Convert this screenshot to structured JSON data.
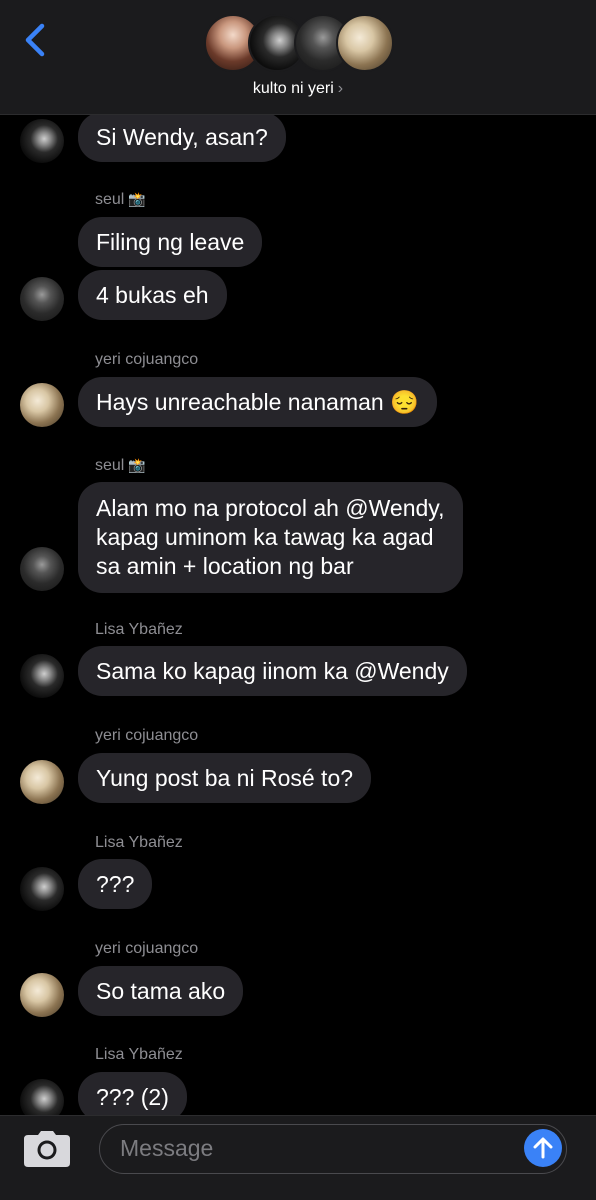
{
  "header": {
    "group_name": "kulto ni yeri",
    "chevron": "›",
    "back_icon": "chevron-left-icon",
    "accent_color": "#3a82f7"
  },
  "messages": [
    {
      "sender": "",
      "text": "Si Wendy, asan?",
      "avatar": "lisa"
    },
    {
      "sender": "seul",
      "sender_emoji": "📸",
      "text": "Filing ng leave",
      "avatar": ""
    },
    {
      "sender": "",
      "text": "4 bukas eh",
      "avatar": "seul"
    },
    {
      "sender": "yeri cojuangco",
      "text": "Hays unreachable nanaman 😔",
      "avatar": "yeri"
    },
    {
      "sender": "seul",
      "sender_emoji": "📸",
      "text": "Alam mo na protocol ah @Wendy, kapag uminom ka tawag ka agad sa amin + location ng bar",
      "lines": [
        "Alam mo na protocol ah @Wendy,",
        "kapag uminom ka tawag ka agad",
        "sa amin + location ng bar"
      ],
      "avatar": "seul"
    },
    {
      "sender": "Lisa Ybañez",
      "text": "Sama ko kapag iinom ka @Wendy",
      "avatar": "lisa"
    },
    {
      "sender": "yeri cojuangco",
      "text": "Yung post ba ni Rosé to?",
      "avatar": "yeri"
    },
    {
      "sender": "Lisa Ybañez",
      "text": "???",
      "avatar": "lisa"
    },
    {
      "sender": "yeri cojuangco",
      "text": "So tama ako",
      "avatar": "yeri"
    },
    {
      "sender": "Lisa Ybañez",
      "text": "??? (2)",
      "avatar": "lisa"
    }
  ],
  "composer": {
    "placeholder": "Message",
    "camera_icon": "camera-icon",
    "send_icon": "arrow-up-icon",
    "send_color": "#3a82f7"
  }
}
